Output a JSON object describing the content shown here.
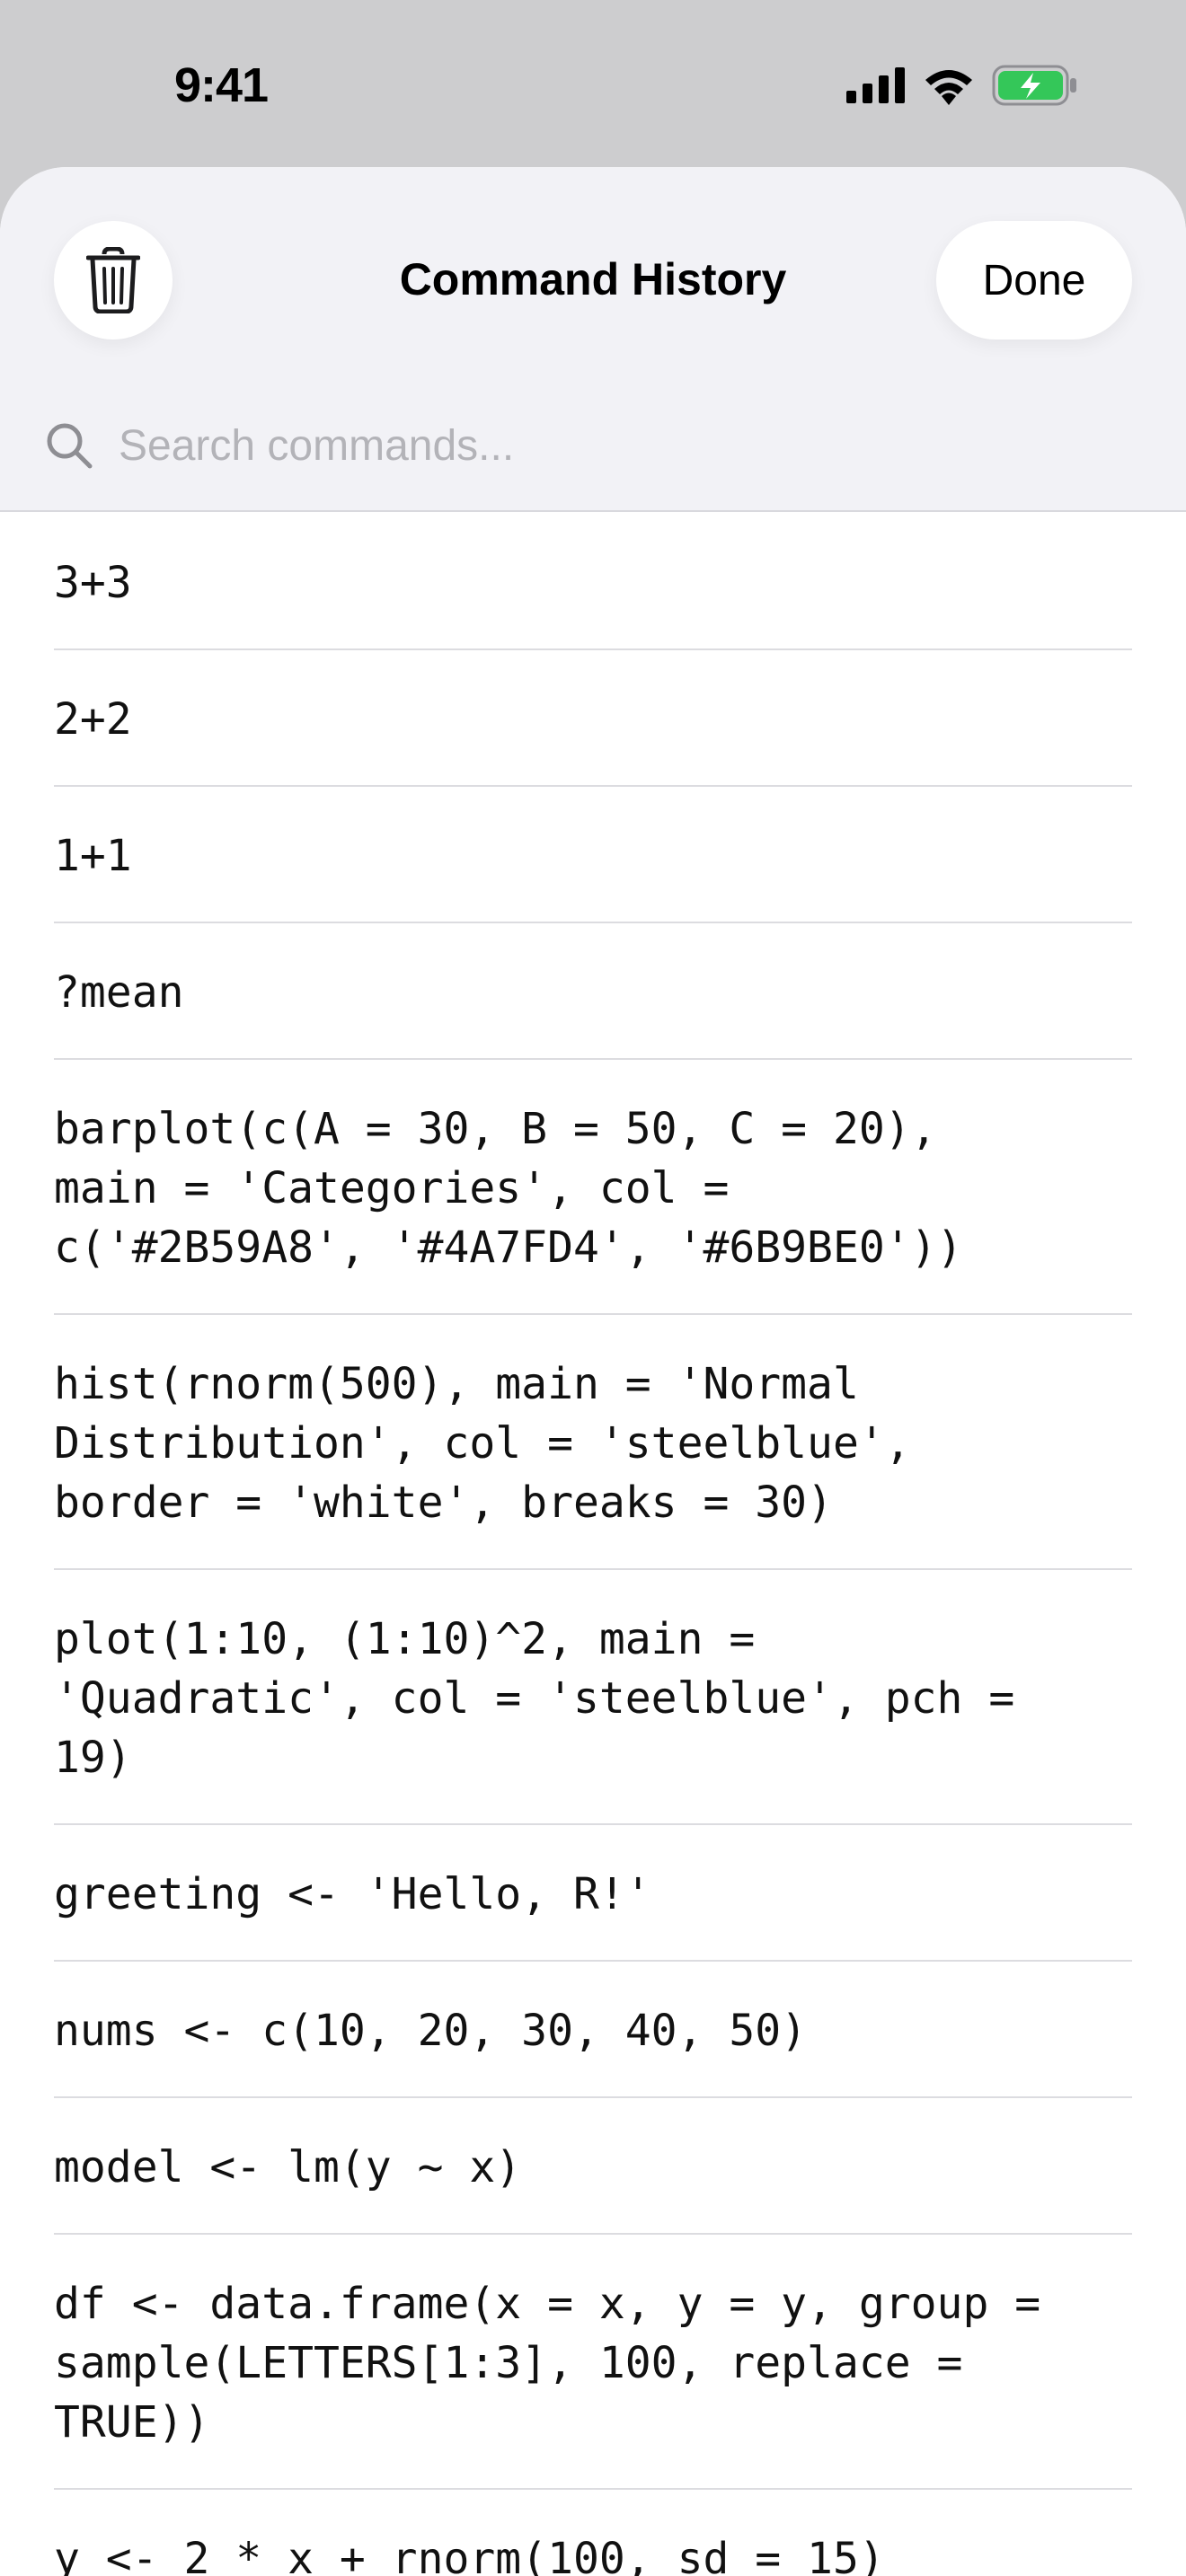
{
  "status_bar": {
    "time": "9:41",
    "icons": [
      "cellular-signal-icon",
      "wifi-icon",
      "battery-charging-icon"
    ],
    "battery_color": "#34c759"
  },
  "sheet": {
    "title": "Command History",
    "done_label": "Done",
    "trash_icon": "trash-icon"
  },
  "search": {
    "placeholder": "Search commands...",
    "value": ""
  },
  "history": {
    "items": [
      "3+3",
      "2+2",
      "1+1",
      "?mean",
      "barplot(c(A = 30, B = 50, C = 20),\nmain = 'Categories', col =\nc('#2B59A8', '#4A7FD4', '#6B9BE0'))",
      "hist(rnorm(500), main = 'Normal\nDistribution', col = 'steelblue',\nborder = 'white', breaks = 30)",
      "plot(1:10, (1:10)^2, main =\n'Quadratic', col = 'steelblue', pch =\n19)",
      "greeting <- 'Hello, R!'",
      "nums <- c(10, 20, 30, 40, 50)",
      "model <- lm(y ~ x)",
      "df <- data.frame(x = x, y = y, group =\nsample(LETTERS[1:3], 100, replace =\nTRUE))",
      "y <- 2 * x + rnorm(100, sd = 15)"
    ]
  }
}
